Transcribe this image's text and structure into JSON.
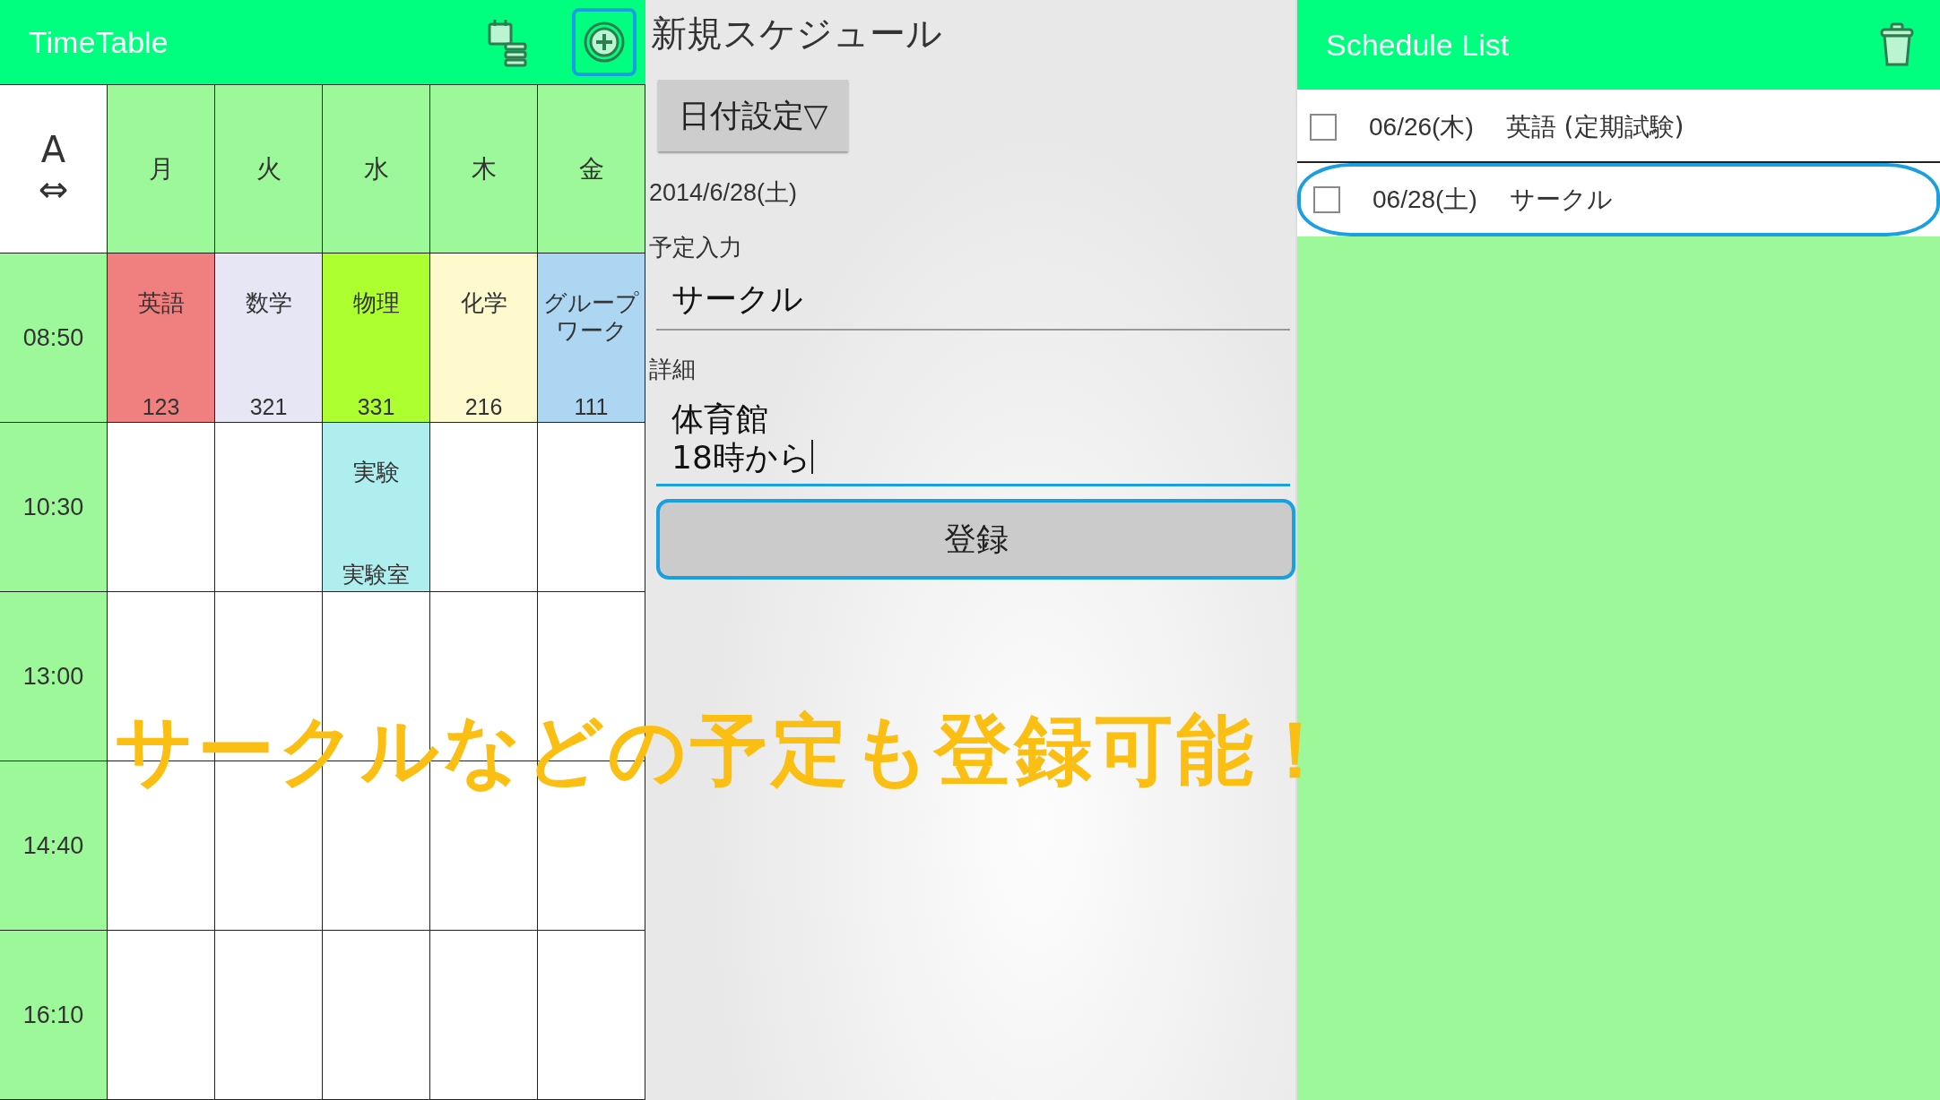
{
  "timetable": {
    "title": "TimeTable",
    "add_button": {
      "highlighted": true
    },
    "corner": {
      "label": "A",
      "symbol": "⇔"
    },
    "days": [
      "月",
      "火",
      "水",
      "木",
      "金"
    ],
    "rows": [
      {
        "time": "08:50",
        "cells": [
          {
            "kind": "lesson",
            "subject": "英語",
            "room": "123",
            "color": "#f08080"
          },
          {
            "kind": "lesson",
            "subject": "数学",
            "room": "321",
            "color": "#e6e6f5"
          },
          {
            "kind": "lesson",
            "subject": "物理",
            "room": "331",
            "color": "#adff2f"
          },
          {
            "kind": "lesson",
            "subject": "化学",
            "room": "216",
            "color": "#fffacd"
          },
          {
            "kind": "lesson",
            "subject": "グループワーク",
            "room": "111",
            "color": "#acd6f2"
          }
        ]
      },
      {
        "time": "10:30",
        "cells": [
          {
            "kind": "empty"
          },
          {
            "kind": "empty"
          },
          {
            "kind": "lesson",
            "subject": "実験",
            "room": "実験室",
            "color": "#afeeee"
          },
          {
            "kind": "empty"
          },
          {
            "kind": "empty"
          }
        ]
      },
      {
        "time": "13:00",
        "cells": [
          {
            "kind": "empty"
          },
          {
            "kind": "empty"
          },
          {
            "kind": "empty"
          },
          {
            "kind": "empty"
          },
          {
            "kind": "empty"
          }
        ]
      },
      {
        "time": "14:40",
        "cells": [
          {
            "kind": "empty"
          },
          {
            "kind": "empty"
          },
          {
            "kind": "empty"
          },
          {
            "kind": "empty"
          },
          {
            "kind": "empty"
          }
        ]
      },
      {
        "time": "16:10",
        "cells": [
          {
            "kind": "empty"
          },
          {
            "kind": "empty"
          },
          {
            "kind": "empty"
          },
          {
            "kind": "empty"
          },
          {
            "kind": "empty"
          }
        ]
      }
    ]
  },
  "new_schedule": {
    "title": "新規スケジュール",
    "date_button": "日付設定▽",
    "date": "2014/6/28(土)",
    "plan_label": "予定入力",
    "plan_value": "サークル",
    "detail_label": "詳細",
    "detail_value": "体育館\n18時から",
    "register_button": {
      "label": "登録",
      "highlighted": true
    }
  },
  "schedule_list": {
    "title": "Schedule List",
    "items": [
      {
        "date": "06/26(木)",
        "subject": "英語 (定期試験)",
        "checked": false,
        "highlighted": false
      },
      {
        "date": "06/28(土)",
        "subject": "サークル",
        "checked": false,
        "highlighted": true
      }
    ]
  },
  "caption": "サークルなどの予定も登録可能！"
}
